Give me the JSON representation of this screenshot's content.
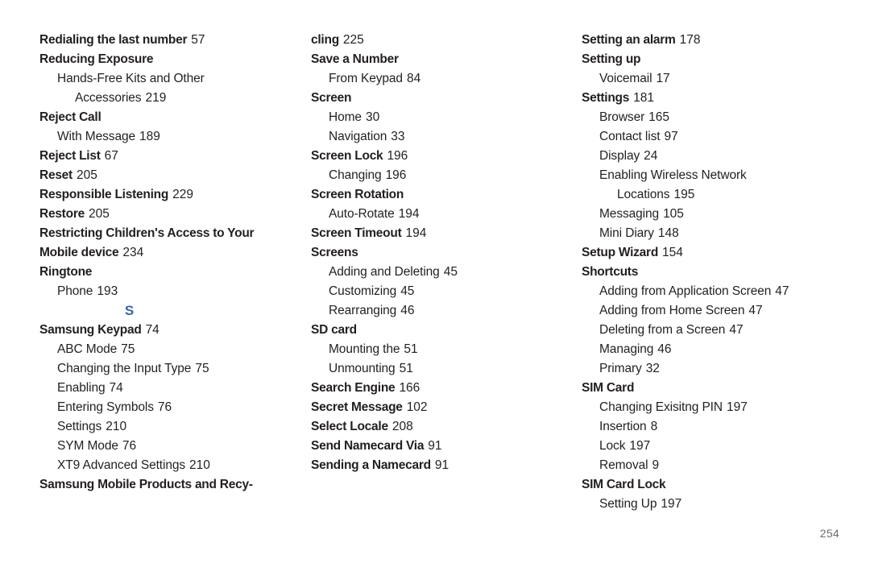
{
  "page": {
    "folio": "254",
    "section_divider": "S",
    "divider_color": "#3c63a8",
    "text_color": "#231f20",
    "background_color": "#ffffff"
  },
  "columns": [
    {
      "id": "column-1",
      "entries": [
        {
          "level": 0,
          "bold": true,
          "term": "Redialing the last number",
          "page": "57"
        },
        {
          "level": 0,
          "bold": true,
          "term": "Reducing Exposure",
          "page": ""
        },
        {
          "level": 1,
          "bold": false,
          "term": "Hands-Free Kits and Other",
          "page": ""
        },
        {
          "level": 2,
          "bold": false,
          "term": "Accessories",
          "page": "219"
        },
        {
          "level": 0,
          "bold": true,
          "term": "Reject Call",
          "page": ""
        },
        {
          "level": 1,
          "bold": false,
          "term": "With Message",
          "page": "189"
        },
        {
          "level": 0,
          "bold": true,
          "term": "Reject List",
          "page": "67"
        },
        {
          "level": 0,
          "bold": true,
          "term": "Reset",
          "page": "205"
        },
        {
          "level": 0,
          "bold": true,
          "term": "Responsible Listening",
          "page": "229"
        },
        {
          "level": 0,
          "bold": true,
          "term": "Restore",
          "page": "205"
        },
        {
          "level": 0,
          "bold": true,
          "term": "Restricting Children's Access to Your",
          "page": ""
        },
        {
          "level": 0,
          "bold": true,
          "term": "Mobile device",
          "page": "234"
        },
        {
          "level": 0,
          "bold": true,
          "term": "Ringtone",
          "page": ""
        },
        {
          "level": 1,
          "bold": false,
          "term": "Phone",
          "page": "193"
        },
        {
          "level": 0,
          "divider": true,
          "term": "S",
          "page": ""
        },
        {
          "level": 0,
          "bold": true,
          "term": "Samsung Keypad",
          "page": "74"
        },
        {
          "level": 1,
          "bold": false,
          "term": "ABC Mode",
          "page": "75"
        },
        {
          "level": 1,
          "bold": false,
          "term": "Changing the Input Type",
          "page": "75"
        },
        {
          "level": 1,
          "bold": false,
          "term": "Enabling",
          "page": "74"
        },
        {
          "level": 1,
          "bold": false,
          "term": "Entering Symbols",
          "page": "76"
        },
        {
          "level": 1,
          "bold": false,
          "term": "Settings",
          "page": "210"
        },
        {
          "level": 1,
          "bold": false,
          "term": "SYM Mode",
          "page": "76"
        },
        {
          "level": 1,
          "bold": false,
          "term": "XT9 Advanced Settings",
          "page": "210"
        },
        {
          "level": 0,
          "bold": true,
          "term": "Samsung Mobile Products and Recy-",
          "page": ""
        }
      ]
    },
    {
      "id": "column-2",
      "entries": [
        {
          "level": 0,
          "bold": true,
          "term": "cling",
          "page": "225"
        },
        {
          "level": 0,
          "bold": true,
          "term": "Save a Number",
          "page": ""
        },
        {
          "level": 1,
          "bold": false,
          "term": "From Keypad",
          "page": "84"
        },
        {
          "level": 0,
          "bold": true,
          "term": "Screen",
          "page": ""
        },
        {
          "level": 1,
          "bold": false,
          "term": "Home",
          "page": "30"
        },
        {
          "level": 1,
          "bold": false,
          "term": "Navigation",
          "page": "33"
        },
        {
          "level": 0,
          "bold": true,
          "term": "Screen Lock",
          "page": "196"
        },
        {
          "level": 1,
          "bold": false,
          "term": "Changing",
          "page": "196"
        },
        {
          "level": 0,
          "bold": true,
          "term": "Screen Rotation",
          "page": ""
        },
        {
          "level": 1,
          "bold": false,
          "term": "Auto-Rotate",
          "page": "194"
        },
        {
          "level": 0,
          "bold": true,
          "term": "Screen Timeout",
          "page": "194"
        },
        {
          "level": 0,
          "bold": true,
          "term": "Screens",
          "page": ""
        },
        {
          "level": 1,
          "bold": false,
          "term": "Adding and Deleting",
          "page": "45"
        },
        {
          "level": 1,
          "bold": false,
          "term": "Customizing",
          "page": "45"
        },
        {
          "level": 1,
          "bold": false,
          "term": "Rearranging",
          "page": "46"
        },
        {
          "level": 0,
          "bold": true,
          "term": "SD card",
          "page": ""
        },
        {
          "level": 1,
          "bold": false,
          "term": "Mounting the",
          "page": "51"
        },
        {
          "level": 1,
          "bold": false,
          "term": "Unmounting",
          "page": "51"
        },
        {
          "level": 0,
          "bold": true,
          "term": "Search Engine",
          "page": "166"
        },
        {
          "level": 0,
          "bold": true,
          "term": "Secret Message",
          "page": "102"
        },
        {
          "level": 0,
          "bold": true,
          "term": "Select Locale",
          "page": "208"
        },
        {
          "level": 0,
          "bold": true,
          "term": "Send Namecard Via",
          "page": "91"
        },
        {
          "level": 0,
          "bold": true,
          "term": "Sending a Namecard",
          "page": "91"
        }
      ]
    },
    {
      "id": "column-3",
      "entries": [
        {
          "level": 0,
          "bold": true,
          "term": "Setting an alarm",
          "page": "178"
        },
        {
          "level": 0,
          "bold": true,
          "term": "Setting up",
          "page": ""
        },
        {
          "level": 1,
          "bold": false,
          "term": "Voicemail",
          "page": "17"
        },
        {
          "level": 0,
          "bold": true,
          "term": "Settings",
          "page": "181"
        },
        {
          "level": 1,
          "bold": false,
          "term": "Browser",
          "page": "165"
        },
        {
          "level": 1,
          "bold": false,
          "term": "Contact list",
          "page": "97"
        },
        {
          "level": 1,
          "bold": false,
          "term": "Display",
          "page": "24"
        },
        {
          "level": 1,
          "bold": false,
          "term": "Enabling Wireless Network",
          "page": ""
        },
        {
          "level": 2,
          "bold": false,
          "term": "Locations",
          "page": "195"
        },
        {
          "level": 1,
          "bold": false,
          "term": "Messaging",
          "page": "105"
        },
        {
          "level": 1,
          "bold": false,
          "term": "Mini Diary",
          "page": "148"
        },
        {
          "level": 0,
          "bold": true,
          "term": "Setup Wizard",
          "page": "154"
        },
        {
          "level": 0,
          "bold": true,
          "term": "Shortcuts",
          "page": ""
        },
        {
          "level": 1,
          "bold": false,
          "term": "Adding from Application Screen",
          "page": "47"
        },
        {
          "level": 1,
          "bold": false,
          "term": "Adding from Home Screen",
          "page": "47"
        },
        {
          "level": 1,
          "bold": false,
          "term": "Deleting from a Screen",
          "page": "47"
        },
        {
          "level": 1,
          "bold": false,
          "term": "Managing",
          "page": "46"
        },
        {
          "level": 1,
          "bold": false,
          "term": "Primary",
          "page": "32"
        },
        {
          "level": 0,
          "bold": true,
          "term": "SIM Card",
          "page": ""
        },
        {
          "level": 1,
          "bold": false,
          "term": "Changing Exisitng PIN",
          "page": "197"
        },
        {
          "level": 1,
          "bold": false,
          "term": "Insertion",
          "page": "8"
        },
        {
          "level": 1,
          "bold": false,
          "term": "Lock",
          "page": "197"
        },
        {
          "level": 1,
          "bold": false,
          "term": "Removal",
          "page": "9"
        },
        {
          "level": 0,
          "bold": true,
          "term": "SIM Card Lock",
          "page": ""
        },
        {
          "level": 1,
          "bold": false,
          "term": "Setting Up",
          "page": "197"
        }
      ]
    }
  ]
}
